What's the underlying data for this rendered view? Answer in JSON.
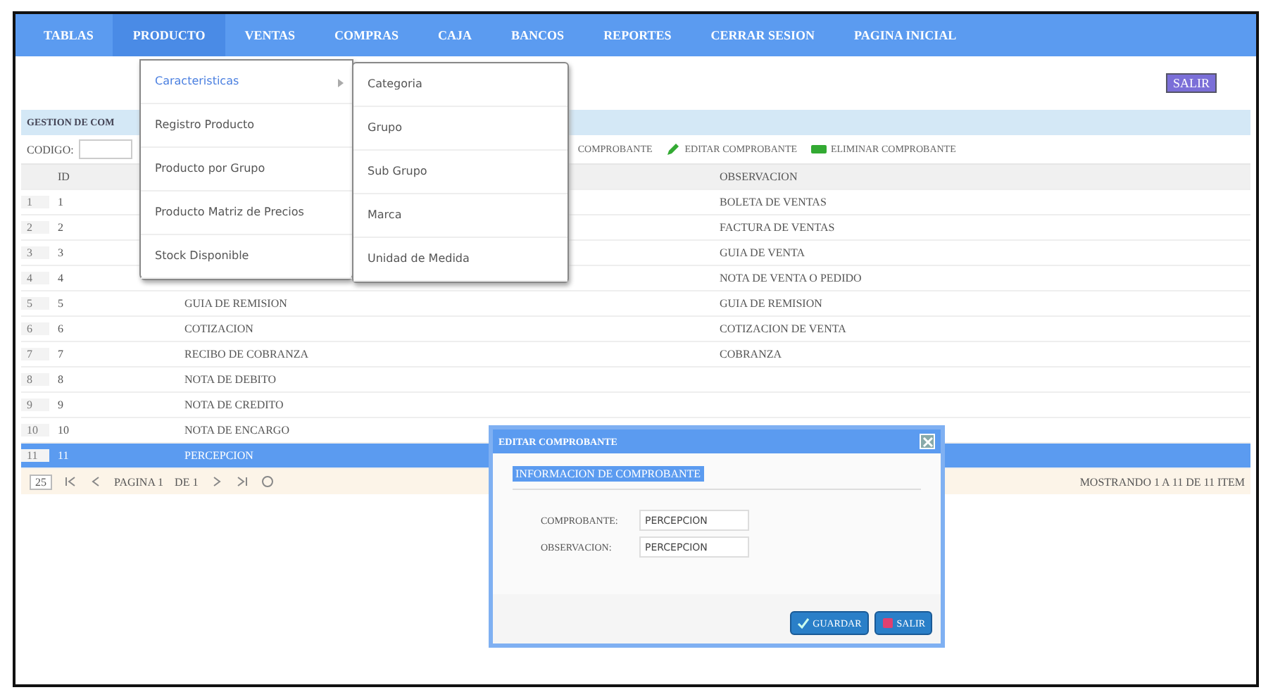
{
  "menu_bar": [
    {
      "label": "TABLAS",
      "selected": false
    },
    {
      "label": "PRODUCTO",
      "selected": true
    },
    {
      "label": "VENTAS",
      "selected": false
    },
    {
      "label": "COMPRAS",
      "selected": false
    },
    {
      "label": "CAJA",
      "selected": false
    },
    {
      "label": "BANCOS",
      "selected": false
    },
    {
      "label": "REPORTES",
      "selected": false
    },
    {
      "label": "CERRAR SESION",
      "selected": false
    },
    {
      "label": "PAGINA INICIAL",
      "selected": false
    }
  ],
  "exit_button": "SALIR",
  "dropdown": [
    {
      "label": "Caracteristicas",
      "selected": true,
      "has_submenu": true
    },
    {
      "label": "Registro Producto",
      "selected": false,
      "has_submenu": false
    },
    {
      "label": "Producto por Grupo",
      "selected": false,
      "has_submenu": false
    },
    {
      "label": "Producto Matriz de Precios",
      "selected": false,
      "has_submenu": false
    },
    {
      "label": "Stock Disponible",
      "selected": false,
      "has_submenu": false
    }
  ],
  "submenu": [
    "Categoria",
    "Grupo",
    "Sub Grupo",
    "Marca",
    "Unidad de Medida"
  ],
  "panel": {
    "title": "GESTION DE COM",
    "search_label": "CODIGO:",
    "toolbar": [
      {
        "label": "COMPROBANTE",
        "kind": "text"
      },
      {
        "label": "EDITAR COMPROBANTE",
        "kind": "edit"
      },
      {
        "label": "ELIMINAR COMPROBANTE",
        "kind": "delete"
      }
    ],
    "columns": [
      "ID",
      "OBSERVACION"
    ],
    "rows": [
      {
        "num": "1",
        "id": "1",
        "name": "",
        "obs": "BOLETA DE VENTAS",
        "selected": false
      },
      {
        "num": "2",
        "id": "2",
        "name": "",
        "obs": "FACTURA DE VENTAS",
        "selected": false
      },
      {
        "num": "3",
        "id": "3",
        "name": "",
        "obs": "GUIA DE VENTA",
        "selected": false
      },
      {
        "num": "4",
        "id": "4",
        "name": "",
        "obs": "NOTA DE VENTA O PEDIDO",
        "selected": false
      },
      {
        "num": "5",
        "id": "5",
        "name": "GUIA DE REMISION",
        "obs": "GUIA DE REMISION",
        "selected": false
      },
      {
        "num": "6",
        "id": "6",
        "name": "COTIZACION",
        "obs": "COTIZACION DE VENTA",
        "selected": false
      },
      {
        "num": "7",
        "id": "7",
        "name": "RECIBO DE COBRANZA",
        "obs": "COBRANZA",
        "selected": false
      },
      {
        "num": "8",
        "id": "8",
        "name": "NOTA DE DEBITO",
        "obs": "",
        "selected": false
      },
      {
        "num": "9",
        "id": "9",
        "name": "NOTA DE CREDITO",
        "obs": "",
        "selected": false
      },
      {
        "num": "10",
        "id": "10",
        "name": "NOTA DE ENCARGO",
        "obs": "",
        "selected": false
      },
      {
        "num": "11",
        "id": "11",
        "name": "PERCEPCION",
        "obs": "",
        "selected": true
      }
    ],
    "pager": {
      "page_size": "25",
      "page_label": "PAGINA 1",
      "of_label": "DE 1",
      "summary": "MOSTRANDO 1 A 11 DE 11 ITEM"
    }
  },
  "dialog": {
    "title": "EDITAR COMPROBANTE",
    "heading": "INFORMACION DE COMPROBANTE",
    "fields": [
      {
        "label": "COMPROBANTE:",
        "value": "PERCEPCION"
      },
      {
        "label": "OBSERVACION:",
        "value": "PERCEPCION"
      }
    ],
    "buttons": [
      {
        "label": "GUARDAR",
        "kind": "save"
      },
      {
        "label": "SALIR",
        "kind": "exit"
      }
    ]
  }
}
